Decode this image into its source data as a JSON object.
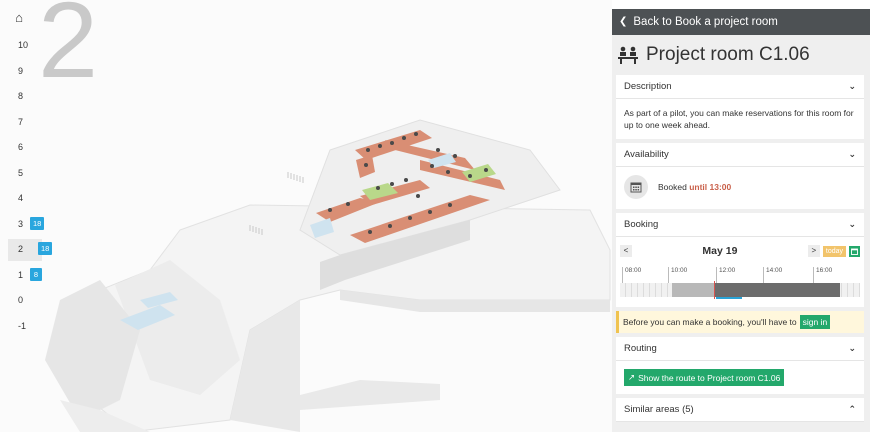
{
  "map": {
    "current_floor_display": "2",
    "floors": [
      {
        "label": "10"
      },
      {
        "label": "9"
      },
      {
        "label": "8"
      },
      {
        "label": "7"
      },
      {
        "label": "6"
      },
      {
        "label": "5"
      },
      {
        "label": "4"
      },
      {
        "label": "3",
        "badge": "18"
      },
      {
        "label": "2",
        "badge": "18",
        "active": true
      },
      {
        "label": "1",
        "badge": "8"
      },
      {
        "label": "0"
      },
      {
        "label": "-1"
      }
    ],
    "colors": {
      "booked": "#d98e74",
      "available": "#b9d88a",
      "glass": "#cfe3ef"
    }
  },
  "panel": {
    "back_label": "Back to Book a project room",
    "room_title": "Project room C1.06",
    "description": {
      "heading": "Description",
      "text": "As part of a pilot, you can make reservations for this room for up to one week ahead."
    },
    "availability": {
      "heading": "Availability",
      "status_text": "Booked",
      "until_text": "until 13:00"
    },
    "booking": {
      "heading": "Booking",
      "prev_label": "<",
      "next_label": ">",
      "date": "May 19",
      "today_label": "today",
      "ticks": [
        "08:00",
        "10:00",
        "12:00",
        "14:00",
        "16:00"
      ]
    },
    "login_note": {
      "text": "Before you can make a booking, you'll have to",
      "signin_label": "sign in"
    },
    "routing": {
      "heading": "Routing",
      "route_button": "Show the route to Project room C1.06"
    },
    "similar": {
      "heading": "Similar areas (5)"
    }
  }
}
